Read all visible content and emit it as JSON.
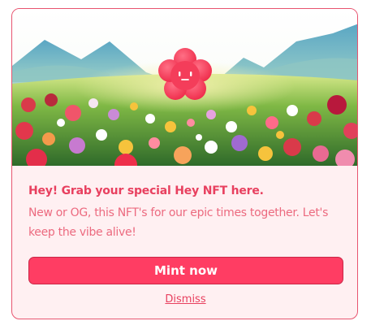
{
  "banner": {
    "image_description": "meadow of colorful flowers with mountains and a smiling pink flower mascot",
    "mascot_icon": "smiling-flower"
  },
  "promo": {
    "title": "Hey! Grab your special Hey NFT here.",
    "description": "New or OG, this NFT's for our epic times together. Let's keep the vibe alive!"
  },
  "actions": {
    "mint_label": "Mint now",
    "dismiss_label": "Dismiss"
  },
  "colors": {
    "accent": "#ff3d63",
    "title": "#e8405f",
    "text": "#ec6a7f",
    "card_bg": "#fff0f2",
    "border": "#e8546f"
  }
}
